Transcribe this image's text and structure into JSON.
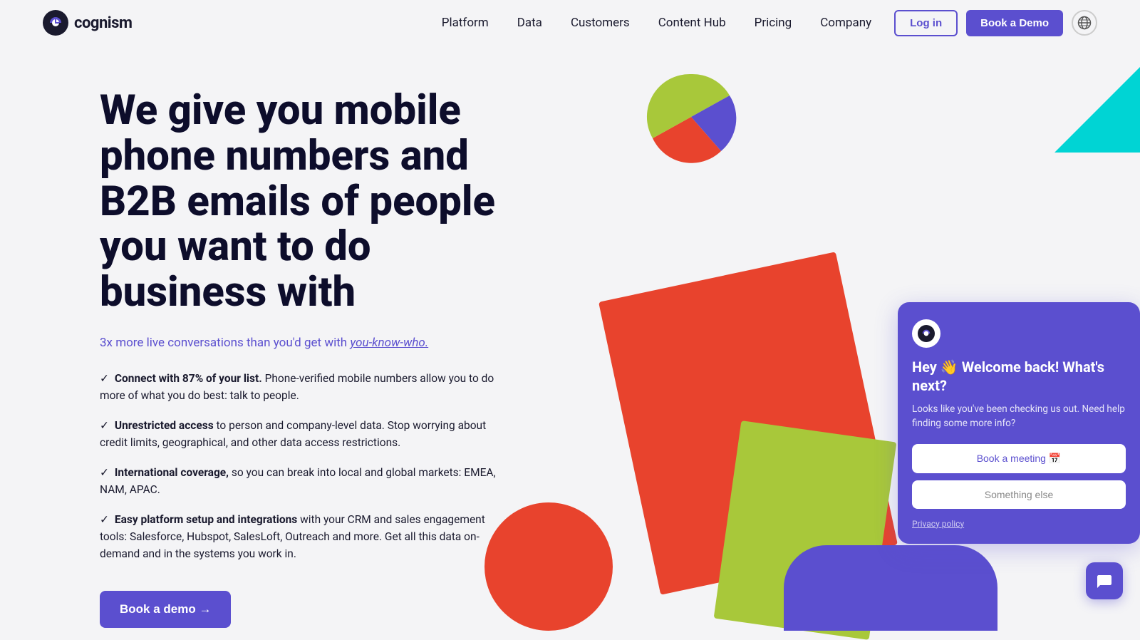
{
  "nav": {
    "logo_text": "cognism",
    "links": [
      {
        "label": "Platform",
        "id": "platform"
      },
      {
        "label": "Data",
        "id": "data"
      },
      {
        "label": "Customers",
        "id": "customers"
      },
      {
        "label": "Content Hub",
        "id": "content-hub"
      },
      {
        "label": "Pricing",
        "id": "pricing"
      },
      {
        "label": "Company",
        "id": "company"
      }
    ],
    "login_label": "Log in",
    "demo_label": "Book a Demo"
  },
  "hero": {
    "title": "We give you mobile phone numbers and B2B emails of people you want to do business with",
    "subtitle_text": "3x more live conversations than you'd get with ",
    "subtitle_italic": "you-know-who.",
    "features": [
      {
        "bold": "Connect with 87% of your list.",
        "text": " Phone-verified mobile numbers allow you to do more of what you do best: talk to people."
      },
      {
        "bold": "Unrestricted access",
        "text": " to person and company-level data. Stop worrying about credit limits, geographical, and other data access restrictions."
      },
      {
        "bold": "International coverage,",
        "text": " so you can break into local and global markets: EMEA, NAM, APAC."
      },
      {
        "bold": "Easy platform setup and integrations",
        "text": " with your CRM and sales engagement tools: Salesforce, Hubspot, SalesLoft, Outreach and more. Get all this data on-demand and in the systems you work in."
      }
    ],
    "cta_label": "Book a demo →"
  },
  "chat_widget": {
    "title": "Hey 👋 Welcome back! What's next?",
    "subtitle": "Looks like you've been checking us out. Need help finding some more info?",
    "btn_meeting": "Book a meeting 📅",
    "btn_else": "Something else",
    "privacy": "Privacy policy"
  },
  "chat_bubble": {
    "tooltip": "Chat"
  }
}
